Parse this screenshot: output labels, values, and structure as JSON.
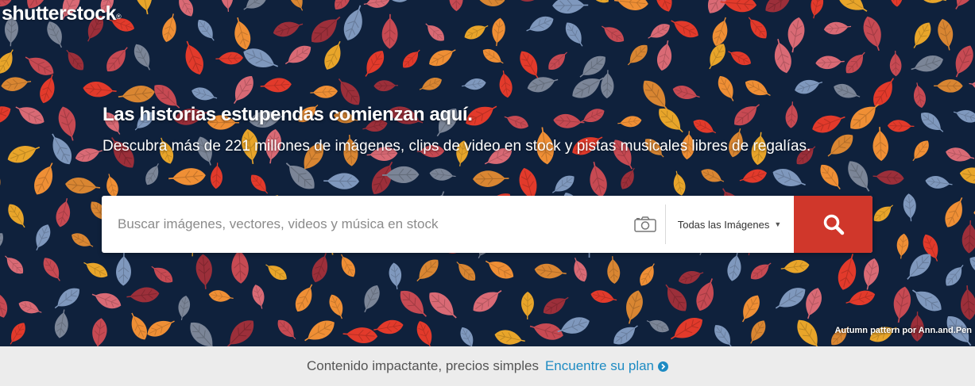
{
  "brand": {
    "name": "shutterstock",
    "trademark": "®"
  },
  "hero": {
    "headline": "Las historias estupendas comienzan aquí.",
    "subhead": "Descubra más de 221 millones de imágenes, clips de video en stock y pistas musicales libres de regalías.",
    "credit": "Autumn pattern por Ann.and.Pen"
  },
  "search": {
    "placeholder": "Buscar imágenes, vectores, videos y música en stock",
    "value": "",
    "camera_icon": "camera-icon",
    "type_selected": "Todas las Imágenes",
    "button_icon": "search-icon"
  },
  "footer_bar": {
    "text": "Contenido impactante, precios simples",
    "link": "Encuentre su plan",
    "link_icon": "chevron-right-circle-icon"
  },
  "colors": {
    "background": "#0f213c",
    "search_button": "#d0372b",
    "link": "#1e8bc3",
    "bottom_bar": "#ececec",
    "leaf_palette": [
      "#e23a2b",
      "#e8a52a",
      "#d98632",
      "#c74a53",
      "#d96a75",
      "#7f98bd",
      "#7b8597",
      "#9c2f3a",
      "#ef8f35"
    ]
  }
}
